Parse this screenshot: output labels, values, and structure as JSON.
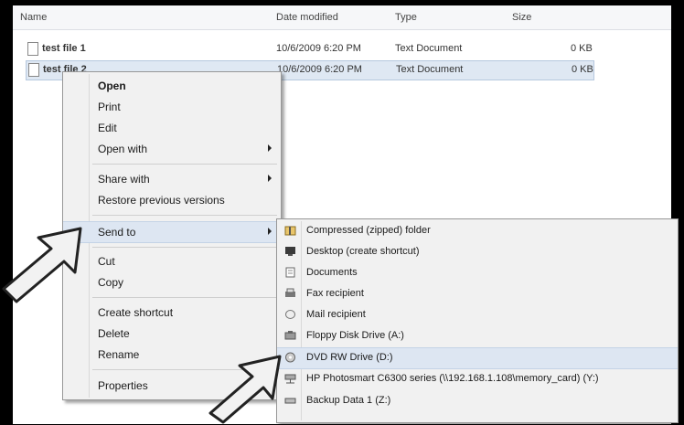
{
  "columns": {
    "name": "Name",
    "date": "Date modified",
    "type": "Type",
    "size": "Size"
  },
  "files": [
    {
      "name": "test file 1",
      "date": "10/6/2009 6:20 PM",
      "type": "Text Document",
      "size": "0 KB"
    },
    {
      "name": "test file 2",
      "date": "10/6/2009 6:20 PM",
      "type": "Text Document",
      "size": "0 KB"
    }
  ],
  "context_menu": {
    "open": "Open",
    "print": "Print",
    "edit": "Edit",
    "open_with": "Open with",
    "share_with": "Share with",
    "restore": "Restore previous versions",
    "send_to": "Send to",
    "cut": "Cut",
    "copy": "Copy",
    "create_shortcut": "Create shortcut",
    "delete": "Delete",
    "rename": "Rename",
    "properties": "Properties"
  },
  "send_to_menu": [
    {
      "label": "Compressed (zipped) folder",
      "icon": "zip-folder-icon"
    },
    {
      "label": "Desktop (create shortcut)",
      "icon": "desktop-icon"
    },
    {
      "label": "Documents",
      "icon": "documents-icon"
    },
    {
      "label": "Fax recipient",
      "icon": "fax-icon"
    },
    {
      "label": "Mail recipient",
      "icon": "mail-icon"
    },
    {
      "label": "Floppy Disk Drive (A:)",
      "icon": "floppy-icon"
    },
    {
      "label": "DVD RW Drive (D:)",
      "icon": "dvd-icon"
    },
    {
      "label": "HP Photosmart C6300 series (\\\\192.168.1.108\\memory_card) (Y:)",
      "icon": "network-drive-icon"
    },
    {
      "label": "Backup Data 1 (Z:)",
      "icon": "drive-icon"
    }
  ]
}
